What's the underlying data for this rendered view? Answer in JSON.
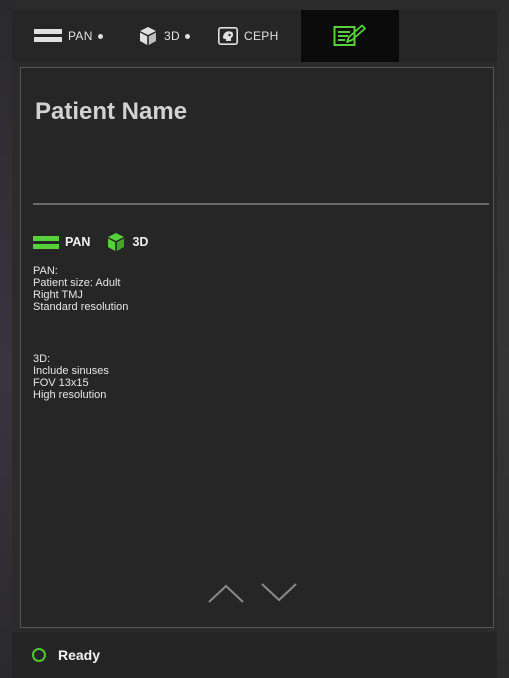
{
  "tabs": [
    {
      "label": "PAN",
      "icon": "pan-bars-icon",
      "has_dot": true
    },
    {
      "label": "3D",
      "icon": "cube-icon",
      "has_dot": true
    },
    {
      "label": "CEPH",
      "icon": "ceph-skull-icon",
      "has_dot": false
    },
    {
      "label": "",
      "icon": "notes-edit-icon",
      "active": true
    }
  ],
  "patient": {
    "name": "Patient Name"
  },
  "modes": [
    {
      "label": "PAN",
      "icon": "pan-bars-icon",
      "color": "#57d13a"
    },
    {
      "label": "3D",
      "icon": "cube-icon",
      "color": "#57d13a"
    }
  ],
  "info": {
    "pan": {
      "title": "PAN:",
      "lines": [
        "Patient size: Adult",
        "Right TMJ",
        "Standard resolution"
      ]
    },
    "d3": {
      "title": "3D:",
      "lines": [
        "Include sinuses",
        "FOV 13x15",
        "High resolution"
      ]
    }
  },
  "navigation": {
    "up_icon": "chevron-up-icon",
    "down_icon": "chevron-down-icon"
  },
  "status": {
    "text": "Ready",
    "color": "#4fc82e"
  }
}
